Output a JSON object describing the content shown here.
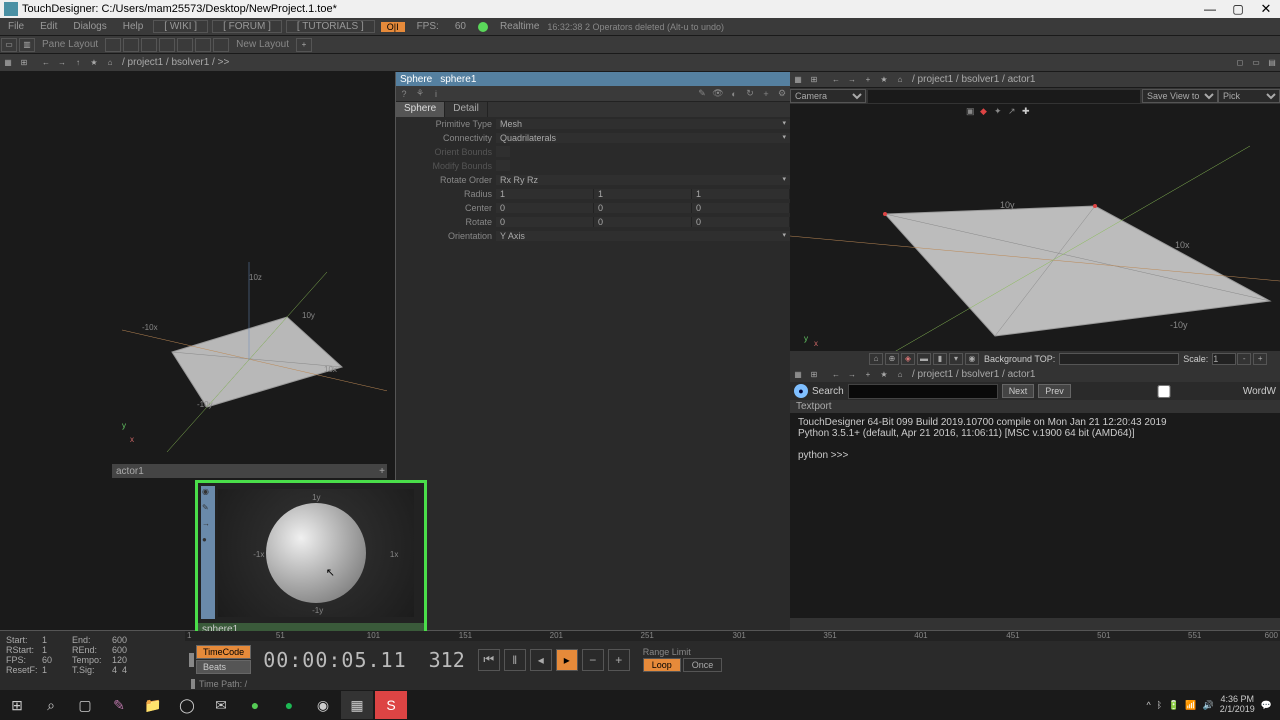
{
  "titlebar": {
    "title": "TouchDesigner: C:/Users/mam25573/Desktop/NewProject.1.toe*"
  },
  "menubar": {
    "file": "File",
    "edit": "Edit",
    "dialogs": "Dialogs",
    "help": "Help",
    "wiki": "[ WIKI ]",
    "forum": "[ FORUM ]",
    "tutorials": "[ TUTORIALS ]",
    "onoff": "O|I",
    "fps_label": "FPS:",
    "fps_value": "60",
    "realtime_label": "Realtime",
    "status": "16:32:38 2 Operators deleted (Alt-u to undo)"
  },
  "panelayout": {
    "label": "Pane Layout",
    "newlayout": "New Layout"
  },
  "path_left": "/ project1 / bsolver1 / >>",
  "nodes": {
    "actor_label": "actor1",
    "sphere_label": "sphere1",
    "axis_1y_top": "1y",
    "axis_1y_bot": "-1y",
    "axis_1x_l": "-1x",
    "axis_1x_r": "1x",
    "axis_10y": "10y",
    "axis_m10y": "-10y",
    "axis_10x": "10x",
    "axis_m10x": "-10x",
    "axis_10z": "10z"
  },
  "params": {
    "header_type": "Sphere",
    "header_name": "sphere1",
    "tab_sphere": "Sphere",
    "tab_detail": "Detail",
    "primtype_label": "Primitive Type",
    "primtype_value": "Mesh",
    "connectivity_label": "Connectivity",
    "connectivity_value": "Quadrilaterals",
    "orient_bounds": "Orient Bounds",
    "modify_bounds": "Modify Bounds",
    "rotate_order_label": "Rotate Order",
    "rotate_order_value": "Rx Ry Rz",
    "radius_label": "Radius",
    "radius_x": "1",
    "radius_y": "1",
    "radius_z": "1",
    "center_label": "Center",
    "center_x": "0",
    "center_y": "0",
    "center_z": "0",
    "rotate_label": "Rotate",
    "rotate_x": "0",
    "rotate_y": "0",
    "rotate_z": "0",
    "orientation_label": "Orientation",
    "orientation_value": "Y Axis"
  },
  "rightview": {
    "camera": "Camera",
    "saveview": "Save View to",
    "pick": "Pick",
    "bgtop_label": "Background TOP:",
    "scale_label": "Scale:",
    "scale_value": "1",
    "path": "/ project1 / bsolver1 / actor1",
    "axis_10y": "10y",
    "axis_m10y": "-10y",
    "axis_10x": "10x"
  },
  "textport": {
    "path": "/ project1 / bsolver1 / actor1",
    "search_label": "Search",
    "next": "Next",
    "prev": "Prev",
    "wordw": "WordW",
    "label": "Textport",
    "line1": "TouchDesigner 64-Bit 099 Build 2019.10700 compile on Mon Jan 21 12:20:43 2019",
    "line2": "Python 3.5.1+ (default, Apr 21 2016, 11:06:11) [MSC v.1900 64 bit (AMD64)]",
    "prompt": "python >>> "
  },
  "timeline": {
    "start_label": "Start:",
    "start_val": "1",
    "end_label": "End:",
    "end_val": "600",
    "rstart_label": "RStart:",
    "rstart_val": "1",
    "rend_label": "REnd:",
    "rend_val": "600",
    "fps_label": "FPS:",
    "fps_val": "60",
    "tempo_label": "Tempo:",
    "tempo_val": "120",
    "reset_label": "ResetF:",
    "reset_val": "1",
    "tsig_label": "T.Sig:",
    "tsig_a": "4",
    "tsig_b": "4",
    "ticks": [
      "1",
      "51",
      "101",
      "151",
      "201",
      "251",
      "301",
      "351",
      "401",
      "451",
      "501",
      "551",
      "600"
    ],
    "timecode_btn": "TimeCode",
    "beats_btn": "Beats",
    "timecode": "00:00:05.11",
    "frame": "312",
    "rangelimit": "Range Limit",
    "loop": "Loop",
    "once": "Once",
    "timepath": "Time Path: /"
  },
  "taskbar": {
    "time": "4:36 PM",
    "date": "2/1/2019"
  }
}
